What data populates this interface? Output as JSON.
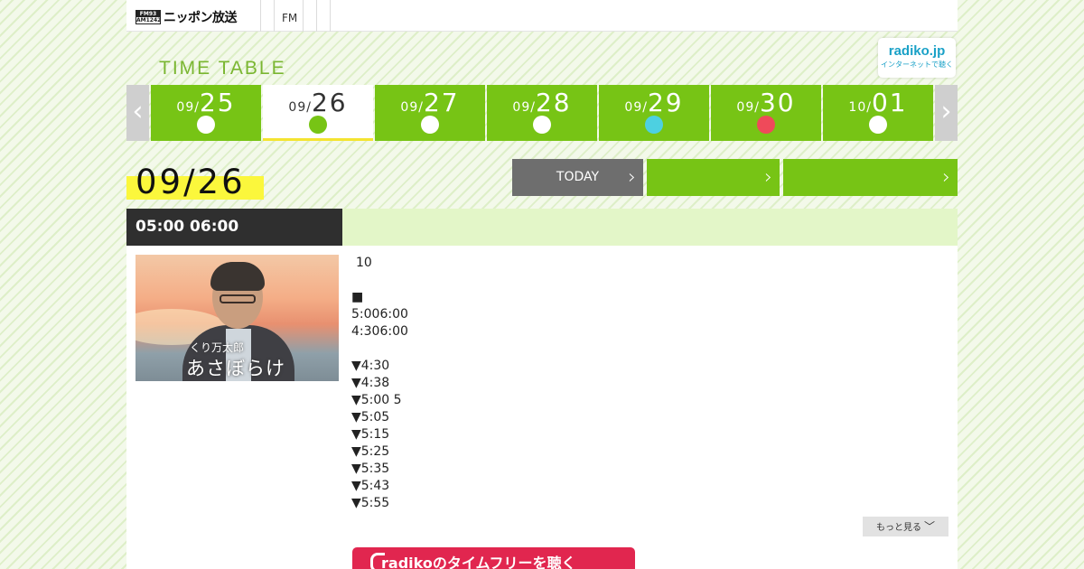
{
  "header": {
    "logo_mark_top": "FM93",
    "logo_mark_bottom": "AM1242",
    "logo_text": "ニッポン放送",
    "nav_fm": "FM"
  },
  "timetable": {
    "title": "TIME TABLE",
    "radiko_main": "radiko.jp",
    "radiko_sub": "インターネットで聴く"
  },
  "days": [
    {
      "month": "09/",
      "day": "25",
      "dot": "#ffffff",
      "active": false
    },
    {
      "month": "09/",
      "day": "26",
      "dot": "#77c415",
      "active": true
    },
    {
      "month": "09/",
      "day": "27",
      "dot": "#ffffff",
      "active": false
    },
    {
      "month": "09/",
      "day": "28",
      "dot": "#ffffff",
      "active": false
    },
    {
      "month": "09/",
      "day": "29",
      "dot": "#4dd0e1",
      "active": false
    },
    {
      "month": "09/",
      "day": "30",
      "dot": "#ef4a5a",
      "active": false
    },
    {
      "month": "10/",
      "day": "01",
      "dot": "#ffffff",
      "active": false
    }
  ],
  "selected_date": "09/26",
  "buttons": {
    "today": "TODAY",
    "prev": "",
    "next": ""
  },
  "program": {
    "time": "05:00  06:00",
    "title": "",
    "thumb_caption_small": "くり万太郎",
    "thumb_caption_large": "あさぼらけ",
    "description": [
      "10",
      "",
      "■",
      "5:006:00",
      "4:306:00",
      "",
      "▼4:30",
      "▼4:38",
      "▼5:00 5",
      "▼5:05",
      "▼5:15",
      "▼5:25",
      "▼5:35",
      "▼5:43",
      "▼5:55"
    ],
    "more_label": "もっと見る",
    "radiko_button": "radikoのタイムフリーを聴く"
  },
  "colors": {
    "accent_green": "#77c415",
    "today_gray": "#6e6e6e",
    "highlight_yellow": "#fbf73c",
    "radiko_red": "#e1264f"
  }
}
